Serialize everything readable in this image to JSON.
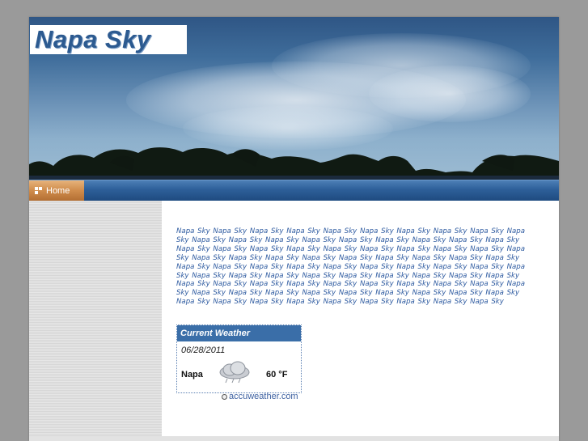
{
  "site": {
    "title": "Napa Sky"
  },
  "nav": {
    "items": [
      {
        "label": "Home"
      }
    ]
  },
  "content": {
    "keyword_block": "Napa Sky  Napa Sky  Napa Sky  Napa Sky  Napa Sky  Napa Sky  Napa Sky  Napa Sky  Napa Sky  Napa Sky  Napa Sky  Napa Sky  Napa Sky  Napa Sky  Napa Sky  Napa Sky  Napa Sky  Napa Sky  Napa Sky  Napa Sky  Napa Sky  Napa Sky  Napa Sky  Napa Sky  Napa Sky  Napa Sky  Napa Sky  Napa Sky  Napa Sky  Napa Sky  Napa Sky  Napa Sky  Napa Sky  Napa Sky  Napa Sky  Napa Sky  Napa Sky  Napa Sky  Napa Sky  Napa Sky  Napa Sky  Napa Sky  Napa Sky  Napa Sky  Napa Sky  Napa Sky  Napa Sky  Napa Sky  Napa Sky  Napa Sky  Napa Sky  Napa Sky  Napa Sky  Napa Sky  Napa Sky  Napa Sky  Napa Sky  Napa Sky  Napa Sky  Napa Sky  Napa Sky  Napa Sky  Napa Sky  Napa Sky  Napa Sky  Napa Sky  Napa Sky  Napa Sky  Napa Sky  Napa Sky  Napa Sky  Napa Sky  Napa Sky  Napa Sky  Napa Sky  Napa Sky  Napa Sky  Napa Sky  Napa Sky  Napa Sky  Napa Sky  Napa Sky  Napa Sky  Napa Sky  Napa Sky"
  },
  "weather": {
    "heading": "Current Weather",
    "date": "06/28/2011",
    "city": "Napa",
    "temperature": "60 °F",
    "condition_icon": "cloudy-rain-icon",
    "credit": "accuweather.com"
  },
  "colors": {
    "page_bg": "#9a9a9a",
    "nav_blue": "#2d5f99",
    "home_tab": "#cf8c4c",
    "link_blue": "#2d5aa0",
    "weather_head": "#3a6ea8"
  }
}
